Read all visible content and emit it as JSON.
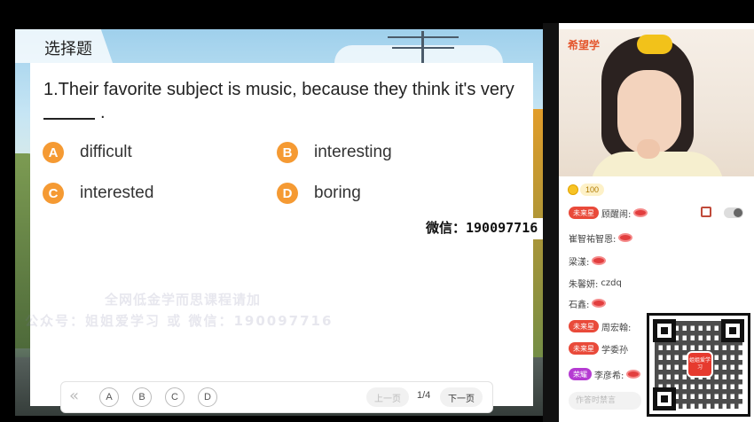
{
  "lesson": {
    "section_title": "选择题",
    "question": "1.Their favorite subject is music, because they think it's very",
    "blank_suffix": ".",
    "options": [
      {
        "letter": "A",
        "text": "difficult"
      },
      {
        "letter": "B",
        "text": "interesting"
      },
      {
        "letter": "C",
        "text": "interested"
      },
      {
        "letter": "D",
        "text": "boring"
      }
    ],
    "wechat_label": "微信：190097716",
    "watermark_line1": "全网低金学而思课程请加",
    "watermark_line2": "公众号：姐姐爱学习 或 微信：190097716"
  },
  "pager": {
    "prev_arrow": "«",
    "answer_buttons": [
      "A",
      "B",
      "C",
      "D"
    ],
    "prev_page": "上一页",
    "page_indicator": "1/4",
    "next_page": "下一页"
  },
  "side": {
    "brand": "希望学",
    "coin_count": "100",
    "chat": [
      {
        "badge": "未来星",
        "badge_color": "#e94a3a",
        "name": "顾醒闹:",
        "content": "",
        "icon": "lips-icon"
      },
      {
        "badge": "",
        "name": "崔智祐智恩:",
        "content": "",
        "icon": "lips-icon"
      },
      {
        "badge": "",
        "name": "梁漾:",
        "content": "",
        "icon": "lips-icon"
      },
      {
        "badge": "",
        "name": "朱馨妍:",
        "content": "czdq",
        "icon": ""
      },
      {
        "badge": "",
        "name": "石鑫:",
        "content": "",
        "icon": "lips-icon"
      },
      {
        "badge": "未来星",
        "badge_color": "#e94a3a",
        "name": "周宏翰:",
        "content": "",
        "icon": ""
      },
      {
        "badge": "未来星",
        "badge_color": "#e94a3a",
        "name": "学委孙",
        "content": "",
        "icon": ""
      },
      {
        "badge": "荣耀",
        "badge_color": "#b53bd2",
        "name": "李彦希:",
        "content": "",
        "icon": "lips-icon"
      }
    ],
    "qr_center_label": "姐姐爱学习",
    "input_placeholder": "作答时禁言"
  },
  "colors": {
    "option_badge": "#f59a33",
    "badge_red": "#e94a3a",
    "badge_purple": "#b53bd2",
    "brand": "#e4572e"
  }
}
